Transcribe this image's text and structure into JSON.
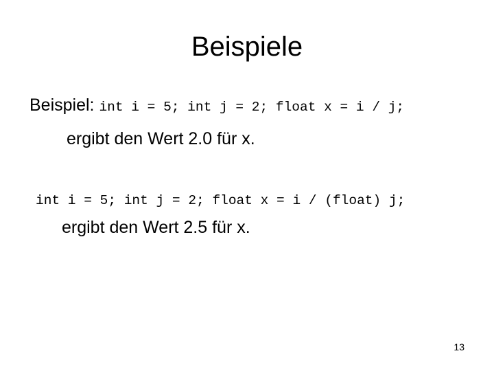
{
  "slide": {
    "title": "Beispiele",
    "example1": {
      "label": "Beispiel: ",
      "code": "int i = 5; int j = 2; float x = i / j;",
      "result": "ergibt den Wert 2.0 für x."
    },
    "example2": {
      "code": "int i = 5; int j = 2; float x = i / (float) j;",
      "result": "ergibt den Wert 2.5 für x."
    },
    "page_number": "13"
  }
}
